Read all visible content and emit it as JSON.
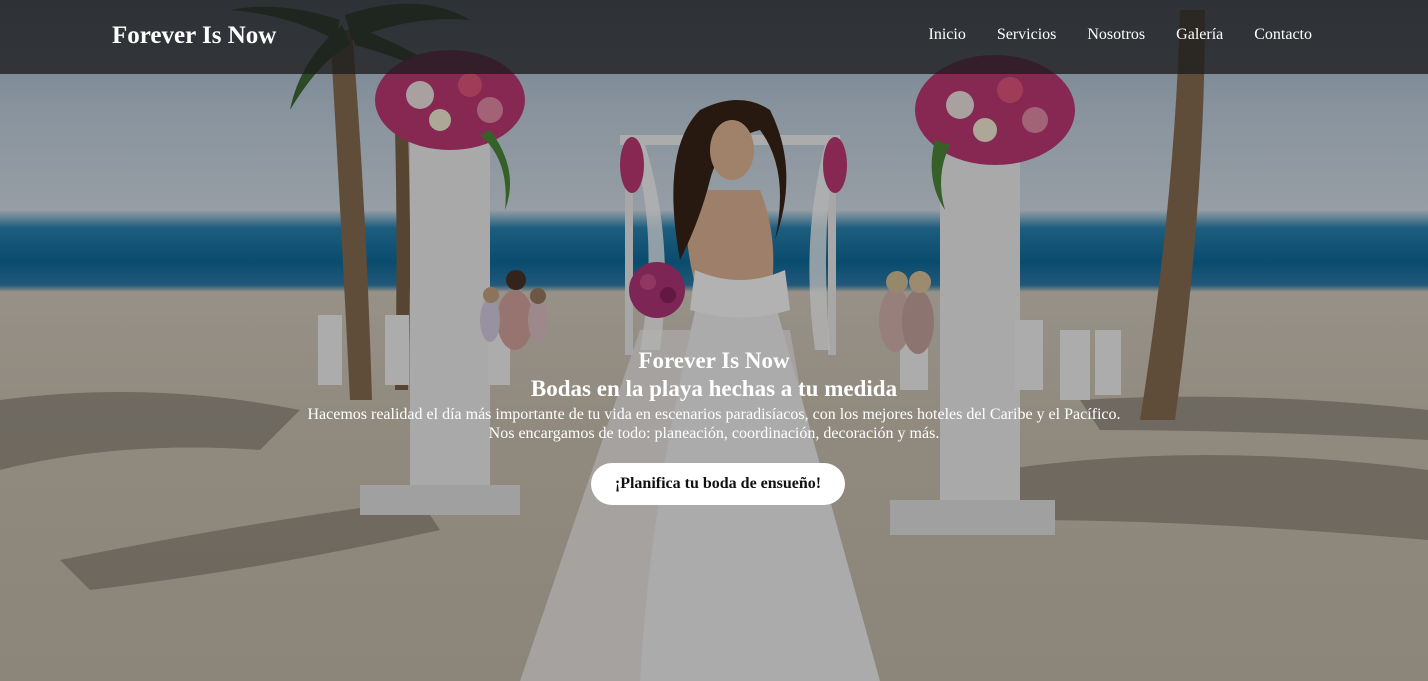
{
  "navbar": {
    "brand": "Forever Is Now",
    "links": [
      "Inicio",
      "Servicios",
      "Nosotros",
      "Galería",
      "Contacto"
    ]
  },
  "hero": {
    "brand": "Forever Is Now",
    "title": "Bodas en la playa hechas a tu medida",
    "description_line1": "Hacemos realidad el día más importante de tu vida en escenarios paradisíacos, con los mejores hoteles del Caribe y el Pacífico.",
    "description_line2": "Nos encargamos de todo: planeación, coordinación, decoración y más.",
    "cta_label": "¡Planifica tu boda de ensueño!",
    "background_image": "beach wedding ceremony with bride, flower-topped white pillars, palm trees, guests on white chairs"
  },
  "colors": {
    "navbar_bg": "#1c1c1e",
    "text": "#ffffff",
    "button_bg": "#ffffff",
    "button_text": "#111111"
  }
}
